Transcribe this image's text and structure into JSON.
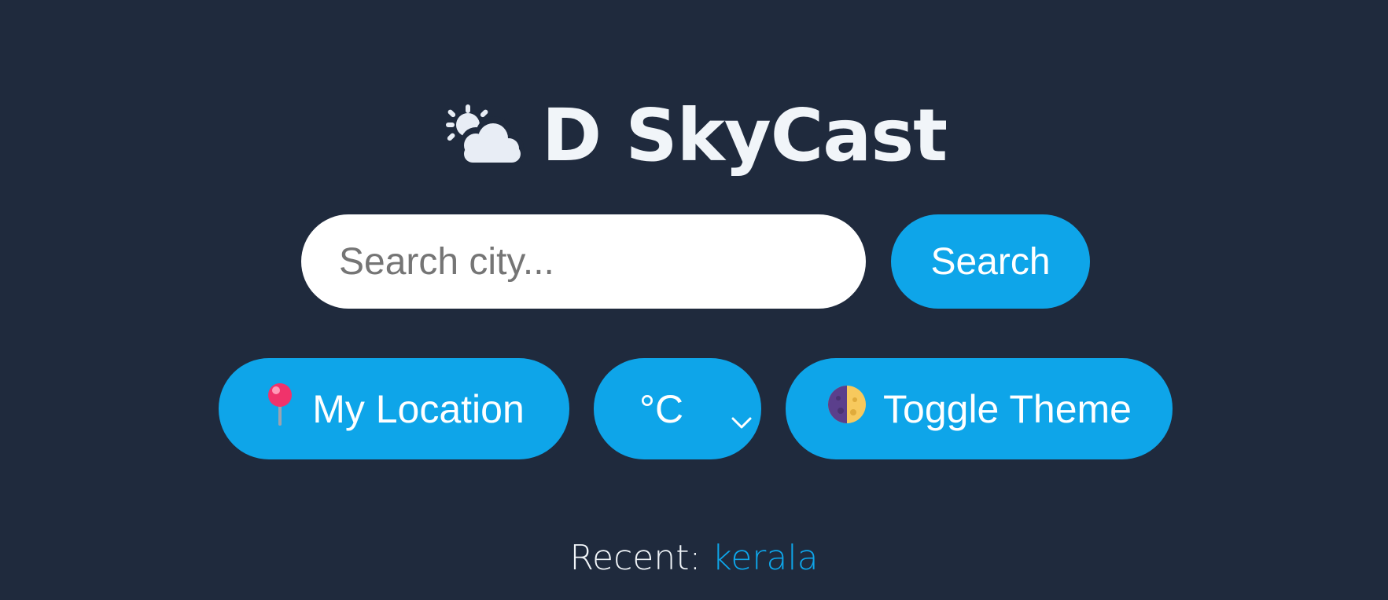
{
  "app": {
    "title": "D SkyCast",
    "logo_icon": "sun-behind-cloud-icon"
  },
  "search": {
    "placeholder": "Search city...",
    "value": "",
    "button_label": "Search"
  },
  "controls": {
    "location_label": "My Location",
    "location_icon": "round-pushpin-icon",
    "unit_selected": "°C",
    "theme_label": "Toggle Theme",
    "theme_icon": "half-moon-icon"
  },
  "recent": {
    "label": "Recent:",
    "items": [
      "kerala"
    ]
  },
  "colors": {
    "background": "#1f2a3d",
    "accent": "#0ea5e9",
    "input_bg": "#ffffff",
    "text": "#f1f5f9"
  }
}
